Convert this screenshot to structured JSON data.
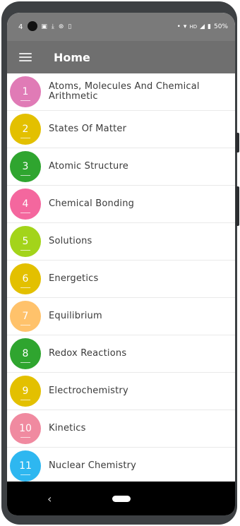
{
  "status_bar": {
    "time_partial": "4",
    "battery": "50%",
    "icons": [
      "notification-icon",
      "download-icon",
      "sync-icon",
      "battery-small-icon",
      "dot-icon",
      "wifi-icon",
      "hd-icon",
      "signal-icon",
      "battery-icon"
    ]
  },
  "app_bar": {
    "title": "Home",
    "menu_icon": "hamburger-menu-icon"
  },
  "chapters": [
    {
      "num": "1",
      "label": "Atoms, Molecules And Chemical Arithmetic",
      "color": "#e07bb6"
    },
    {
      "num": "2",
      "label": "States Of Matter",
      "color": "#e3c000"
    },
    {
      "num": "3",
      "label": "Atomic Structure",
      "color": "#2fa52f"
    },
    {
      "num": "4",
      "label": "Chemical Bonding",
      "color": "#f4679e"
    },
    {
      "num": "5",
      "label": "Solutions",
      "color": "#a3d41a"
    },
    {
      "num": "6",
      "label": "Energetics",
      "color": "#e3c000"
    },
    {
      "num": "7",
      "label": "Equilibrium",
      "color": "#ffc26b"
    },
    {
      "num": "8",
      "label": "Redox Reactions",
      "color": "#2fa52f"
    },
    {
      "num": "9",
      "label": "Electrochemistry",
      "color": "#e3c000"
    },
    {
      "num": "10",
      "label": "Kinetics",
      "color": "#f08aa0"
    },
    {
      "num": "11",
      "label": "Nuclear Chemistry",
      "color": "#2eb7f0"
    }
  ],
  "nav_bar": {
    "back_icon": "back-triangle-icon",
    "home_icon": "home-pill-icon"
  }
}
